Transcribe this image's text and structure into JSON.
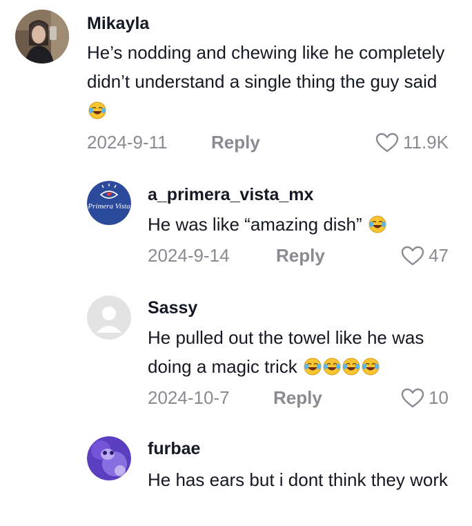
{
  "comments": [
    {
      "username": "Mikayla",
      "text": "He’s nodding and chewing like he completely didn’t understand a single thing the guy said",
      "emoji": "😂",
      "date": "2024-9-11",
      "reply_label": "Reply",
      "likes": "11.9K"
    },
    {
      "username": "a_primera_vista_mx",
      "avatar_logo_text": "Primera Vista",
      "text": "He was like “amazing dish”",
      "emoji": "😂",
      "date": "2024-9-14",
      "reply_label": "Reply",
      "likes": "47"
    },
    {
      "username": "Sassy",
      "text": "He pulled out the towel like he was doing a magic trick",
      "emoji": "😂😂😂😂",
      "date": "2024-10-7",
      "reply_label": "Reply",
      "likes": "10"
    },
    {
      "username": "furbae",
      "text": "He has ears but i dont think they work"
    }
  ],
  "colors": {
    "text": "#161823",
    "muted": "#8a8b91",
    "logo_blue": "#2b4a9b"
  },
  "icons": {
    "like": "heart-outline-icon",
    "emoji": "laughing-tears-emoji"
  }
}
